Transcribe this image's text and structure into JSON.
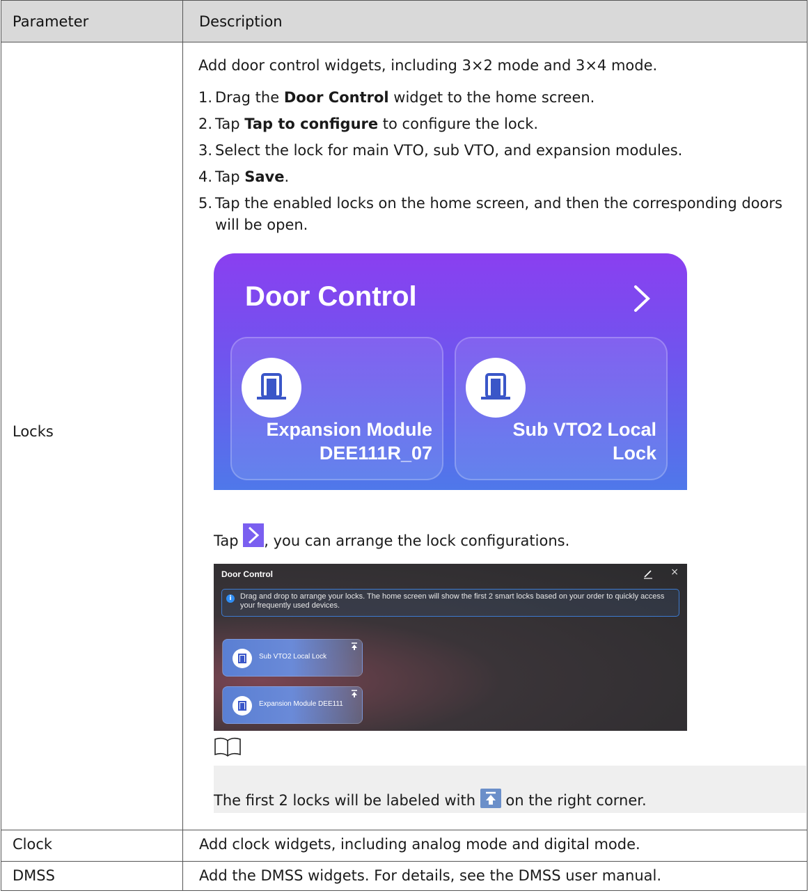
{
  "header": {
    "parameter": "Parameter",
    "description": "Description"
  },
  "rows": {
    "locks": {
      "param": "Locks",
      "intro": "Add door control widgets, including 3×2 mode and 3×4 mode.",
      "steps": [
        {
          "num": "1.",
          "pre": "Drag the ",
          "bold": "Door Control",
          "post": "  widget to the home screen."
        },
        {
          "num": "2.",
          "pre": "Tap ",
          "bold": "Tap to configure",
          "post": "  to configure the lock."
        },
        {
          "num": "3.",
          "pre": "Select the lock for main VTO, sub VTO, and expansion modules.",
          "bold": "",
          "post": ""
        },
        {
          "num": "4.",
          "pre": "Tap ",
          "bold": "Save",
          "post": "."
        },
        {
          "num": "5.",
          "pre": "Tap the enabled locks on the home screen, and then the corresponding doors will be open.",
          "bold": "",
          "post": ""
        }
      ],
      "widget": {
        "title": "Door Control",
        "card1_line1": "Expansion Module",
        "card1_line2": "DEE111R_07",
        "card2_line1": "Sub VTO2 Local",
        "card2_line2": "Lock"
      },
      "tap_pre": "Tap",
      "tap_post": ", you can arrange the lock configurations.",
      "panel": {
        "title": "Door Control",
        "close": "×",
        "info": "Drag and drop to arrange your locks. The home screen will show the first 2 smart locks based on your order to quickly access your frequently used devices.",
        "lock1": "Sub VTO2 Local Lock",
        "lock2": "Expansion Module DEE111"
      },
      "note_pre": "The first 2 locks will be labeled with",
      "note_post": "on the right corner."
    },
    "clock": {
      "param": "Clock",
      "desc": "Add clock widgets, including analog mode and digital mode."
    },
    "dmss": {
      "param": "DMSS",
      "desc": "Add the DMSS widgets. For details, see the DMSS user manual."
    }
  },
  "colors": {
    "header_bg": "#d9d9d9",
    "widget_top": "#8a3ff0",
    "widget_bottom": "#4f78ea",
    "note_bg": "#efefef"
  }
}
